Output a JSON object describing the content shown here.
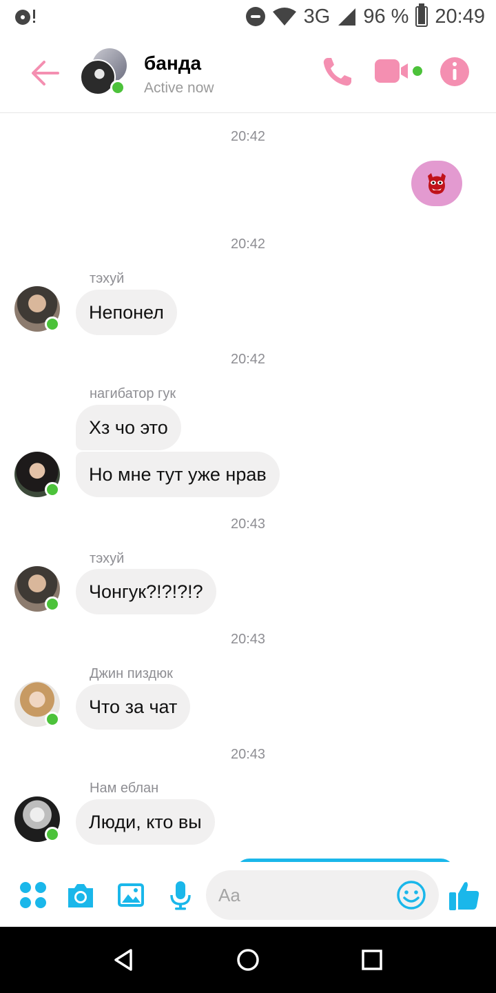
{
  "status_bar": {
    "network": "3G",
    "battery": "96 %",
    "battery_level": 0.96,
    "time": "20:49"
  },
  "header": {
    "title": "банда",
    "status": "Active now"
  },
  "messages": [
    {
      "type": "timestamp",
      "text": "20:42"
    },
    {
      "type": "outgoing-sticker",
      "sticker": "👹"
    },
    {
      "type": "timestamp",
      "text": "20:42"
    },
    {
      "type": "incoming",
      "sender": "тэхуй",
      "texts": [
        "Непонел"
      ]
    },
    {
      "type": "timestamp",
      "text": "20:42"
    },
    {
      "type": "incoming",
      "sender": "нагибатор гук",
      "texts": [
        "Хз чо это",
        "Но мне тут уже нрав"
      ]
    },
    {
      "type": "timestamp",
      "text": "20:43"
    },
    {
      "type": "incoming",
      "sender": "тэхуй",
      "texts": [
        "Чонгук?!?!?!?"
      ]
    },
    {
      "type": "timestamp",
      "text": "20:43"
    },
    {
      "type": "incoming",
      "sender": "Джин пиздюк",
      "texts": [
        "Что за чат"
      ]
    },
    {
      "type": "timestamp",
      "text": "20:43"
    },
    {
      "type": "incoming",
      "sender": "Нам еблан",
      "texts": [
        "Люди, кто вы"
      ]
    }
  ],
  "composer": {
    "placeholder": "Aa",
    "value": ""
  },
  "colors": {
    "accent_pink": "#f48fb1",
    "accent_blue": "#1ab7ea",
    "online_green": "#4cc23a",
    "sticker_bubble": "#e39ad0",
    "incoming_bubble": "#f1f0f0"
  },
  "icons": {
    "header": [
      "back-arrow-icon",
      "phone-icon",
      "video-camera-icon",
      "info-icon"
    ],
    "composer": [
      "more-apps-icon",
      "camera-icon",
      "gallery-icon",
      "microphone-icon",
      "emoji-icon",
      "thumbs-up-icon"
    ],
    "nav": [
      "nav-back-icon",
      "nav-home-icon",
      "nav-recents-icon"
    ]
  }
}
